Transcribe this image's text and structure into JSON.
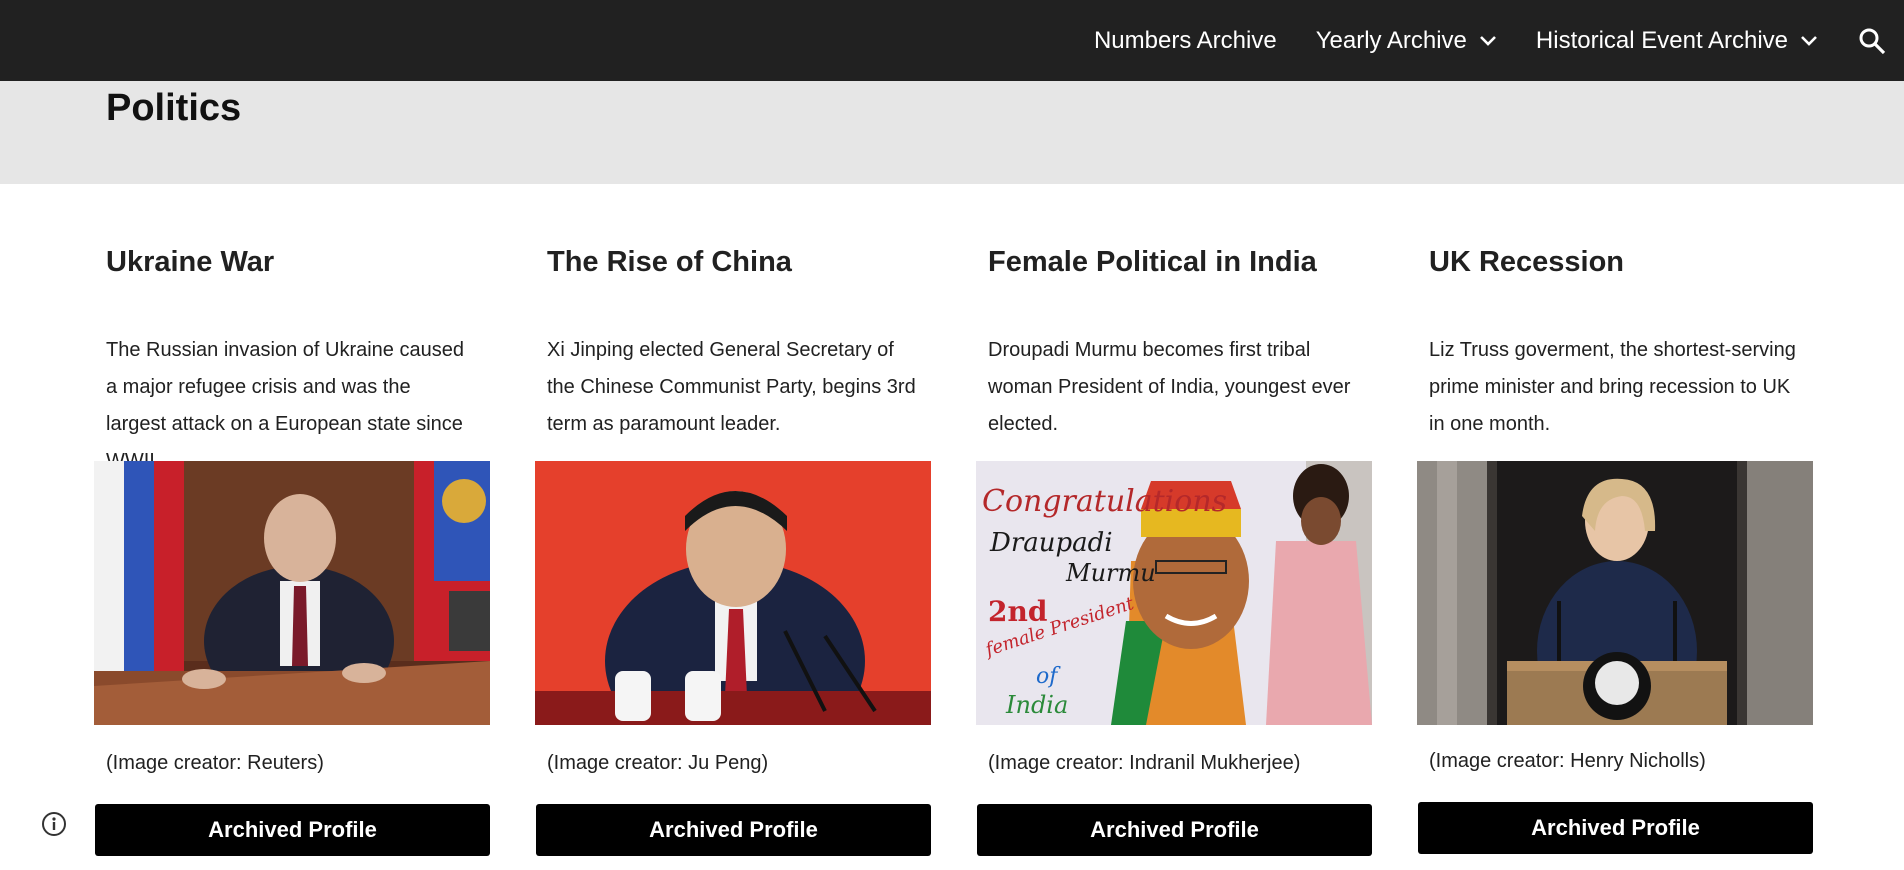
{
  "nav": {
    "items": [
      {
        "label": "Numbers Archive",
        "has_dropdown": false
      },
      {
        "label": "Yearly Archive",
        "has_dropdown": true
      },
      {
        "label": "Historical Event Archive",
        "has_dropdown": true
      }
    ],
    "search_icon": "search-icon"
  },
  "header": {
    "title": "Politics"
  },
  "cards": [
    {
      "title": "Ukraine War",
      "description": "The Russian invasion of Ukraine caused a major refugee crisis and was the largest attack on a European state since WWII.",
      "credit": "(Image creator:  Reuters)",
      "button": "Archived Profile"
    },
    {
      "title": "The Rise of China",
      "description": "Xi Jinping elected General Secretary of the Chinese Communist Party, begins 3rd term as paramount leader.",
      "credit": "(Image creator:  Ju Peng)",
      "button": "Archived Profile"
    },
    {
      "title": "Female Political in India",
      "description": "Droupadi Murmu becomes first tribal woman President of India, youngest ever elected.",
      "credit": "(Image creator:  Indranil Mukherjee)",
      "button": "Archived Profile"
    },
    {
      "title": "UK Recession",
      "description": "Liz Truss goverment, the shortest-serving prime minister and bring recession to UK in one month.",
      "credit": "(Image creator:  Henry Nicholls)",
      "button": "Archived Profile"
    }
  ],
  "painting_text": {
    "line1": "Congratulations",
    "line2": "Draupadi",
    "line3": "Murmu",
    "line4": "2nd",
    "line5": "female President",
    "line6": "of",
    "line7": "India"
  },
  "colors": {
    "topbar": "#212121",
    "header_band": "#e6e6e6",
    "button_bg": "#000000",
    "button_text": "#ffffff"
  },
  "info_icon": "info-icon"
}
